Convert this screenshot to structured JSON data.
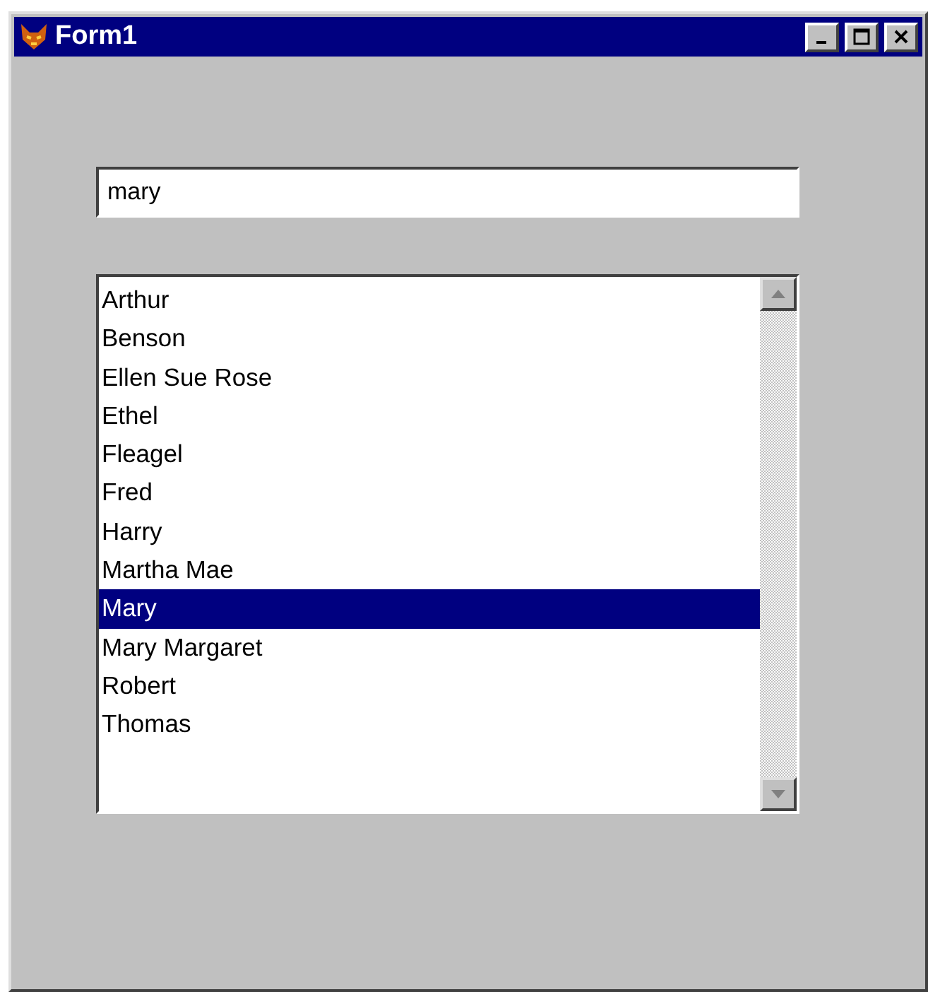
{
  "window": {
    "title": "Form1"
  },
  "search": {
    "value": "mary"
  },
  "list": {
    "items": [
      {
        "label": "Arthur",
        "selected": false
      },
      {
        "label": "Benson",
        "selected": false
      },
      {
        "label": "Ellen Sue Rose",
        "selected": false
      },
      {
        "label": "Ethel",
        "selected": false
      },
      {
        "label": "Fleagel",
        "selected": false
      },
      {
        "label": "Fred",
        "selected": false
      },
      {
        "label": "Harry",
        "selected": false
      },
      {
        "label": "Martha Mae",
        "selected": false
      },
      {
        "label": "Mary",
        "selected": true
      },
      {
        "label": "Mary Margaret",
        "selected": false
      },
      {
        "label": "Robert",
        "selected": false
      },
      {
        "label": "Thomas",
        "selected": false
      }
    ]
  }
}
